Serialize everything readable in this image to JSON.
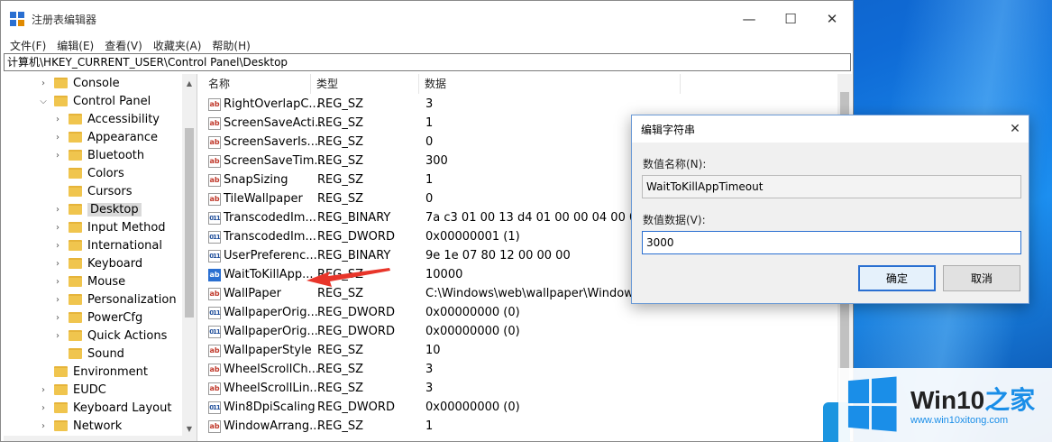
{
  "window": {
    "title": "注册表编辑器",
    "controls": {
      "minimize": "—",
      "maximize": "☐",
      "close": "✕"
    }
  },
  "menu": [
    "文件(F)",
    "编辑(E)",
    "查看(V)",
    "收藏夹(A)",
    "帮助(H)"
  ],
  "address": "计算机\\HKEY_CURRENT_USER\\Control Panel\\Desktop",
  "tree": [
    {
      "label": "Console",
      "expanded": false
    },
    {
      "label": "Control Panel",
      "expanded": true
    },
    {
      "label": "Accessibility"
    },
    {
      "label": "Appearance"
    },
    {
      "label": "Bluetooth"
    },
    {
      "label": "Colors"
    },
    {
      "label": "Cursors"
    },
    {
      "label": "Desktop",
      "selected": true
    },
    {
      "label": "Input Method"
    },
    {
      "label": "International"
    },
    {
      "label": "Keyboard"
    },
    {
      "label": "Mouse"
    },
    {
      "label": "Personalization"
    },
    {
      "label": "PowerCfg"
    },
    {
      "label": "Quick Actions"
    },
    {
      "label": "Sound"
    },
    {
      "label": "Environment"
    },
    {
      "label": "EUDC"
    },
    {
      "label": "Keyboard Layout"
    },
    {
      "label": "Network"
    }
  ],
  "columns": {
    "name": "名称",
    "type": "类型",
    "data": "数据"
  },
  "rows": [
    {
      "name": "RightOverlapC...",
      "type": "REG_SZ",
      "data": "3",
      "icon": "string-value-icon"
    },
    {
      "name": "ScreenSaveActi...",
      "type": "REG_SZ",
      "data": "1",
      "icon": "string-value-icon"
    },
    {
      "name": "ScreenSaverIs...",
      "type": "REG_SZ",
      "data": "0",
      "icon": "string-value-icon"
    },
    {
      "name": "ScreenSaveTim...",
      "type": "REG_SZ",
      "data": "300",
      "icon": "string-value-icon"
    },
    {
      "name": "SnapSizing",
      "type": "REG_SZ",
      "data": "1",
      "icon": "string-value-icon"
    },
    {
      "name": "TileWallpaper",
      "type": "REG_SZ",
      "data": "0",
      "icon": "string-value-icon"
    },
    {
      "name": "TranscodedIm...",
      "type": "REG_BINARY",
      "data": "7a c3 01 00 13 d4 01 00 00 04 00 00 00",
      "icon": "binary-value-icon"
    },
    {
      "name": "TranscodedIm...",
      "type": "REG_DWORD",
      "data": "0x00000001 (1)",
      "icon": "binary-value-icon"
    },
    {
      "name": "UserPreferenc...",
      "type": "REG_BINARY",
      "data": "9e 1e 07 80 12 00 00 00",
      "icon": "binary-value-icon"
    },
    {
      "name": "WaitToKillApp...",
      "type": "REG_SZ",
      "data": "10000",
      "icon": "string-value-icon",
      "highlighted": true
    },
    {
      "name": "WallPaper",
      "type": "REG_SZ",
      "data": "C:\\Windows\\web\\wallpaper\\Windows\\img",
      "icon": "string-value-icon"
    },
    {
      "name": "WallpaperOrig...",
      "type": "REG_DWORD",
      "data": "0x00000000 (0)",
      "icon": "binary-value-icon"
    },
    {
      "name": "WallpaperOrig...",
      "type": "REG_DWORD",
      "data": "0x00000000 (0)",
      "icon": "binary-value-icon"
    },
    {
      "name": "WallpaperStyle",
      "type": "REG_SZ",
      "data": "10",
      "icon": "string-value-icon"
    },
    {
      "name": "WheelScrollCh...",
      "type": "REG_SZ",
      "data": "3",
      "icon": "string-value-icon"
    },
    {
      "name": "WheelScrollLin...",
      "type": "REG_SZ",
      "data": "3",
      "icon": "string-value-icon"
    },
    {
      "name": "Win8DpiScaling",
      "type": "REG_DWORD",
      "data": "0x00000000 (0)",
      "icon": "binary-value-icon"
    },
    {
      "name": "WindowArrang...",
      "type": "REG_SZ",
      "data": "1",
      "icon": "string-value-icon"
    }
  ],
  "dialog": {
    "title": "编辑字符串",
    "close": "✕",
    "name_label": "数值名称(N):",
    "name_value": "WaitToKillAppTimeout",
    "data_label": "数值数据(V):",
    "data_value": "3000",
    "ok": "确定",
    "cancel": "取消"
  },
  "watermark": {
    "brand": "Win10",
    "brand_zh": "之家",
    "url": "www.win10xitong.com"
  },
  "colors": {
    "accent": "#2a6fd1",
    "annotation_arrow": "#e8352a",
    "watermark_blue": "#1a8ee8"
  }
}
